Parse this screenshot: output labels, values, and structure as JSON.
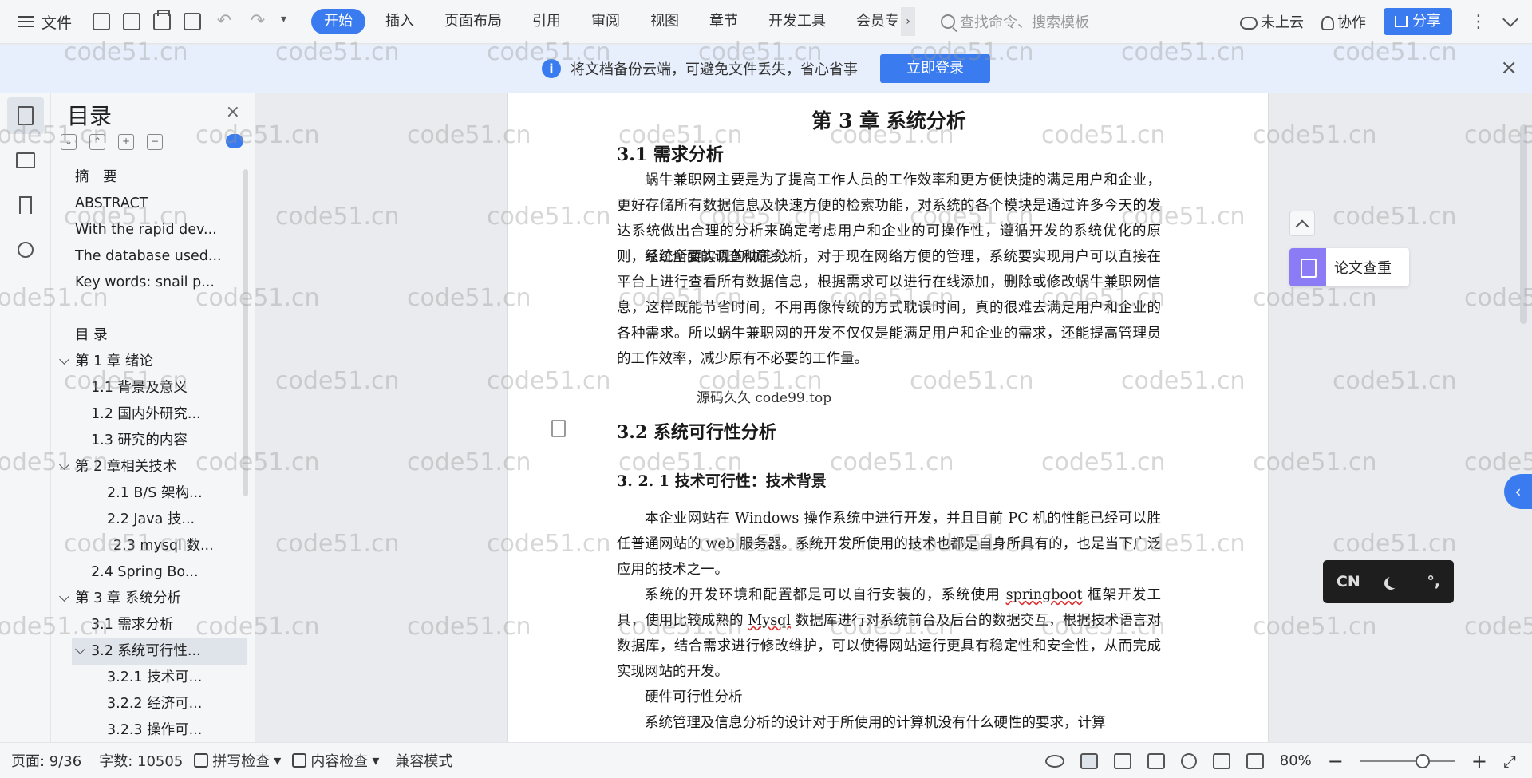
{
  "topbar": {
    "file_label": "文件",
    "tabs": [
      "开始",
      "插入",
      "页面布局",
      "引用",
      "审阅",
      "视图",
      "章节",
      "开发工具",
      "会员专"
    ],
    "tab_more": "›",
    "search_placeholder": "查找命令、搜索模板",
    "cloud_label": "未上云",
    "collab_label": "协作",
    "share_label": "分享"
  },
  "notice": {
    "message": "将文档备份云端，可避免文件丢失，省心省事",
    "login_label": "立即登录"
  },
  "toc": {
    "title": "目录",
    "items": [
      {
        "label": "摘　要",
        "level": 0,
        "caret": false
      },
      {
        "label": "ABSTRACT",
        "level": 0,
        "caret": false
      },
      {
        "label": "With the rapid dev...",
        "level": 0,
        "caret": false
      },
      {
        "label": "The database used...",
        "level": 0,
        "caret": false
      },
      {
        "label": "Key words: snail p...",
        "level": 0,
        "caret": false
      },
      {
        "label": "",
        "level": 0,
        "caret": false
      },
      {
        "label": "目 录",
        "level": 0,
        "caret": false
      },
      {
        "label": "第 1 章  绪论",
        "level": 0,
        "caret": true
      },
      {
        "label": "1.1 背景及意义",
        "level": 1,
        "caret": false
      },
      {
        "label": "1.2  国内外研究...",
        "level": 1,
        "caret": false
      },
      {
        "label": "1.3  研究的内容",
        "level": 1,
        "caret": false
      },
      {
        "label": "第 2 章相关技术",
        "level": 0,
        "caret": true
      },
      {
        "label": "2.1    B/S 架构...",
        "level": 2,
        "caret": false
      },
      {
        "label": "2.2    Java 技...",
        "level": 2,
        "caret": false
      },
      {
        "label": "2.3 mysql 数...",
        "level": 3,
        "caret": false
      },
      {
        "label": "2.4 Spring    Bo...",
        "level": 1,
        "caret": false
      },
      {
        "label": "第 3 章  系统分析",
        "level": 0,
        "caret": true
      },
      {
        "label": "3.1  需求分析",
        "level": 1,
        "caret": false
      },
      {
        "label": "3.2  系统可行性...",
        "level": 1,
        "caret": true,
        "selected": true
      },
      {
        "label": "3.2.1 技术可...",
        "level": 2,
        "caret": false
      },
      {
        "label": "3.2.2 经济可...",
        "level": 2,
        "caret": false
      },
      {
        "label": "3.2.3 操作可...",
        "level": 2,
        "caret": false
      }
    ]
  },
  "document": {
    "chapter_title": "第 3 章  系统分析",
    "s31_title": "3.1  需求分析",
    "s31_p1": "蜗牛兼职网主要是为了提高工作人员的工作效率和更方便快捷的满足用户和企业，更好存储所有数据信息及快速方便的检索功能，对系统的各个模块是通过许多今天的发达系统做出合理的分析来确定考虑用户和企业的可操作性，遵循开发的系统优化的原则，经过全面的调查和研究。",
    "s31_p2": "系统所要实现的功能分析，对于现在网络方便的管理，系统要实现用户可以直接在平台上进行查看所有数据信息，根据需求可以进行在线添加，删除或修改蜗牛兼职网信息，这样既能节省时间，不用再像传统的方式耽误时间，真的很难去满足用户和企业的各种需求。所以蜗牛兼职网的开发不仅仅是能满足用户和企业的需求，还能提高管理员的工作效率，减少原有不必要的工作量。",
    "overlay": "源码久久  code99.top",
    "s32_title": "3.2  系统可行性分析",
    "s321_title": "3. 2. 1 技术可行性：技术背景",
    "s321_p1": "本企业网站在 Windows 操作系统中进行开发，并且目前 PC 机的性能已经可以胜任普通网站的 web 服务器。系统开发所使用的技术也都是自身所具有的，也是当下广泛应用的技术之一。",
    "s321_p2_a": "系统的开发环境和配置都是可以自行安装的，系统使用 ",
    "s321_p2_w1": "springboot",
    "s321_p2_b": " 框架开发工具，使用比较成熟的 ",
    "s321_p2_w2": "Mysql",
    "s321_p2_c": " 数据库进行对系统前台及后台的数据交互，根据技术语言对数据库，结合需求进行修改维护，可以使得网站运行更具有稳定性和安全性，从而完成实现网站的开发。",
    "hw_title": "硬件可行性分析",
    "hw_p": "系统管理及信息分析的设计对于所使用的计算机没有什么硬性的要求，计算"
  },
  "floating": {
    "thesis_label": "论文查重",
    "ime_lang": "CN",
    "ime_punct": "°,",
    "side_tab": "‹"
  },
  "watermark": "code51.cn",
  "status": {
    "page": "页面: 9/36",
    "words": "字数: 10505",
    "spell": "拼写检查",
    "content_check": "内容检查",
    "compat": "兼容模式",
    "zoom": "80%"
  }
}
